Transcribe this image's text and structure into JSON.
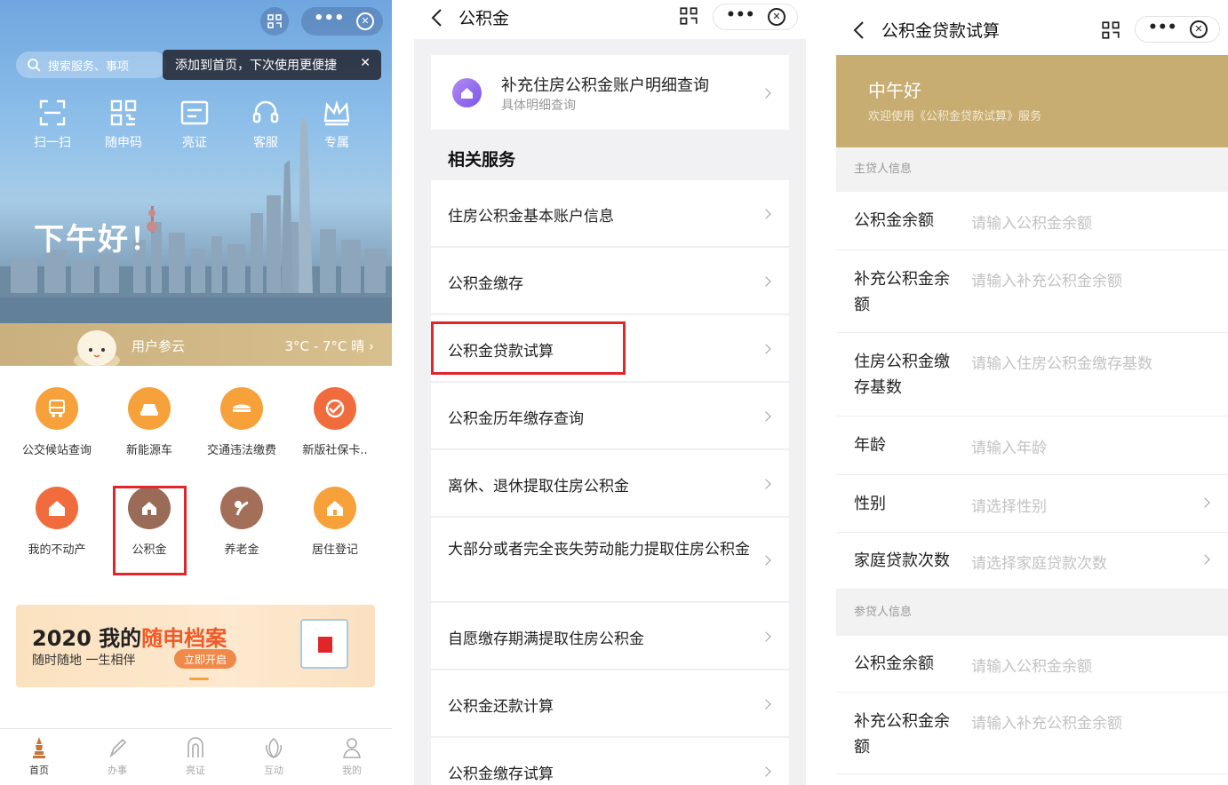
{
  "panel1": {
    "search_placeholder": "搜索服务、事项",
    "tooltip": "添加到首页，下次使用更便捷",
    "quick_actions": [
      "扫一扫",
      "随申码",
      "亮证",
      "客服",
      "专属"
    ],
    "greeting": "下午好！",
    "weather_location": "用户参云",
    "weather_temp": "3°C - 7°C 晴",
    "services": [
      {
        "label": "公交候站查询",
        "color": "#f7a13a"
      },
      {
        "label": "新能源车",
        "color": "#f7a13a"
      },
      {
        "label": "交通违法缴费",
        "color": "#f7a13a"
      },
      {
        "label": "新版社保卡..",
        "color": "#f16c3c"
      },
      {
        "label": "我的不动产",
        "color": "#f16c3c"
      },
      {
        "label": "公积金",
        "color": "#9a6b57"
      },
      {
        "label": "养老金",
        "color": "#a36f58"
      },
      {
        "label": "居住登记",
        "color": "#f7a13a"
      }
    ],
    "banner": {
      "year": "2020 我的",
      "highlight": "随申档案",
      "slogan": "随时随地 一生相伴",
      "button": "立即开启"
    },
    "tabs": [
      "首页",
      "办事",
      "亮证",
      "互动",
      "我的"
    ]
  },
  "panel2": {
    "title": "公积金",
    "top_card": {
      "title": "补充住房公积金账户明细查询",
      "subtitle": "具体明细查询"
    },
    "section_title": "相关服务",
    "items": [
      "住房公积金基本账户信息",
      "公积金缴存",
      "公积金贷款试算",
      "公积金历年缴存查询",
      "离休、退休提取住房公积金",
      "大部分或者完全丧失劳动能力提取住房公积金",
      "自愿缴存期满提取住房公积金",
      "公积金还款计算",
      "公积金缴存试算"
    ]
  },
  "panel3": {
    "title": "公积金贷款试算",
    "greeting": "中午好",
    "welcome": "欢迎使用《公积金贷款试算》服务",
    "main_borrower_header": "主贷人信息",
    "main_fields": [
      {
        "label": "公积金余额",
        "placeholder": "请输入公积金余额"
      },
      {
        "label": "补充公积金余额",
        "placeholder": "请输入补充公积金余额"
      },
      {
        "label": "住房公积金缴存基数",
        "placeholder": "请输入住房公积金缴存基数"
      },
      {
        "label": "年龄",
        "placeholder": "请输入年龄"
      },
      {
        "label": "性别",
        "placeholder": "请选择性别"
      },
      {
        "label": "家庭贷款次数",
        "placeholder": "请选择家庭贷款次数"
      }
    ],
    "co_borrower_header": "参贷人信息",
    "co_fields": [
      {
        "label": "公积金余额",
        "placeholder": "请输入公积金余额"
      },
      {
        "label": "补充公积金余额",
        "placeholder": "请输入补充公积金余额"
      }
    ]
  }
}
